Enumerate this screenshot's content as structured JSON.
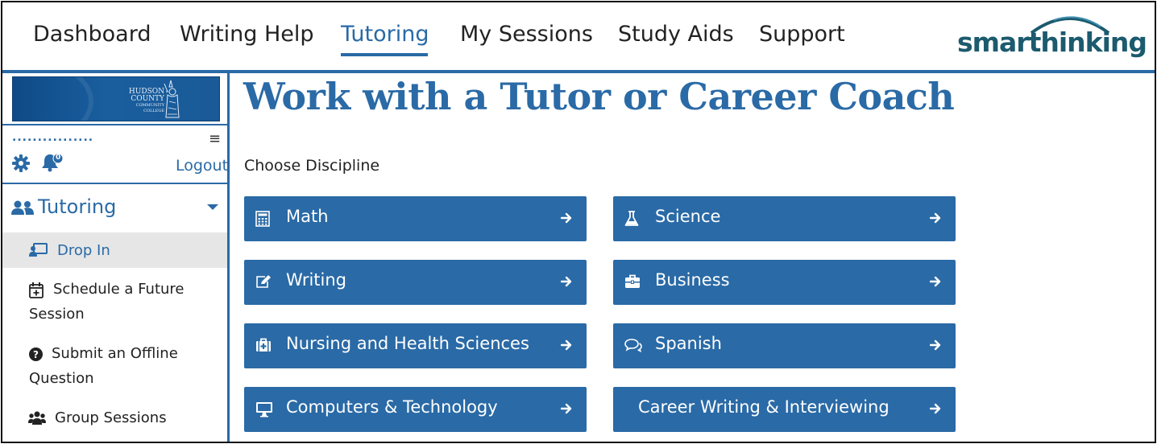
{
  "topnav": {
    "items": [
      {
        "label": "Dashboard"
      },
      {
        "label": "Writing Help"
      },
      {
        "label": "Tutoring"
      },
      {
        "label": "My Sessions"
      },
      {
        "label": "Study Aids"
      },
      {
        "label": "Support"
      }
    ],
    "active": "Tutoring",
    "logo_text": "smarthinking"
  },
  "sidebar": {
    "banner": {
      "line1": "HUDSON",
      "line2": "COUNTY",
      "line3": "COMMUNITY COLLEGE"
    },
    "username_mask": "................",
    "notification_count": "0",
    "logout_label": "Logout",
    "section_label": "Tutoring",
    "items": [
      {
        "label": "Drop In",
        "icon": "drop-in-icon"
      },
      {
        "label_line1": "Schedule a Future",
        "label_line2": "Session",
        "icon": "calendar-plus-icon"
      },
      {
        "label_line1": "Submit an Offline",
        "label_line2": "Question",
        "icon": "question-circle-icon"
      },
      {
        "label": "Group Sessions",
        "icon": "group-icon"
      }
    ]
  },
  "main": {
    "title": "Work with a Tutor or Career Coach",
    "choose_label": "Choose Discipline",
    "disciplines": [
      {
        "label": "Math",
        "icon": "calculator-icon"
      },
      {
        "label": "Science",
        "icon": "flask-icon"
      },
      {
        "label": "Writing",
        "icon": "edit-icon"
      },
      {
        "label": "Business",
        "icon": "briefcase-icon"
      },
      {
        "label": "Nursing and Health Sciences",
        "icon": "medkit-icon"
      },
      {
        "label": "Spanish",
        "icon": "chat-icon"
      },
      {
        "label": "Computers & Technology",
        "icon": "monitor-icon"
      },
      {
        "label": "Career Writing & Interviewing",
        "icon": ""
      }
    ]
  },
  "colors": {
    "accent": "#2a6aa6",
    "logo": "#1c5a6e",
    "active_item_bg": "#e6e6e6"
  }
}
